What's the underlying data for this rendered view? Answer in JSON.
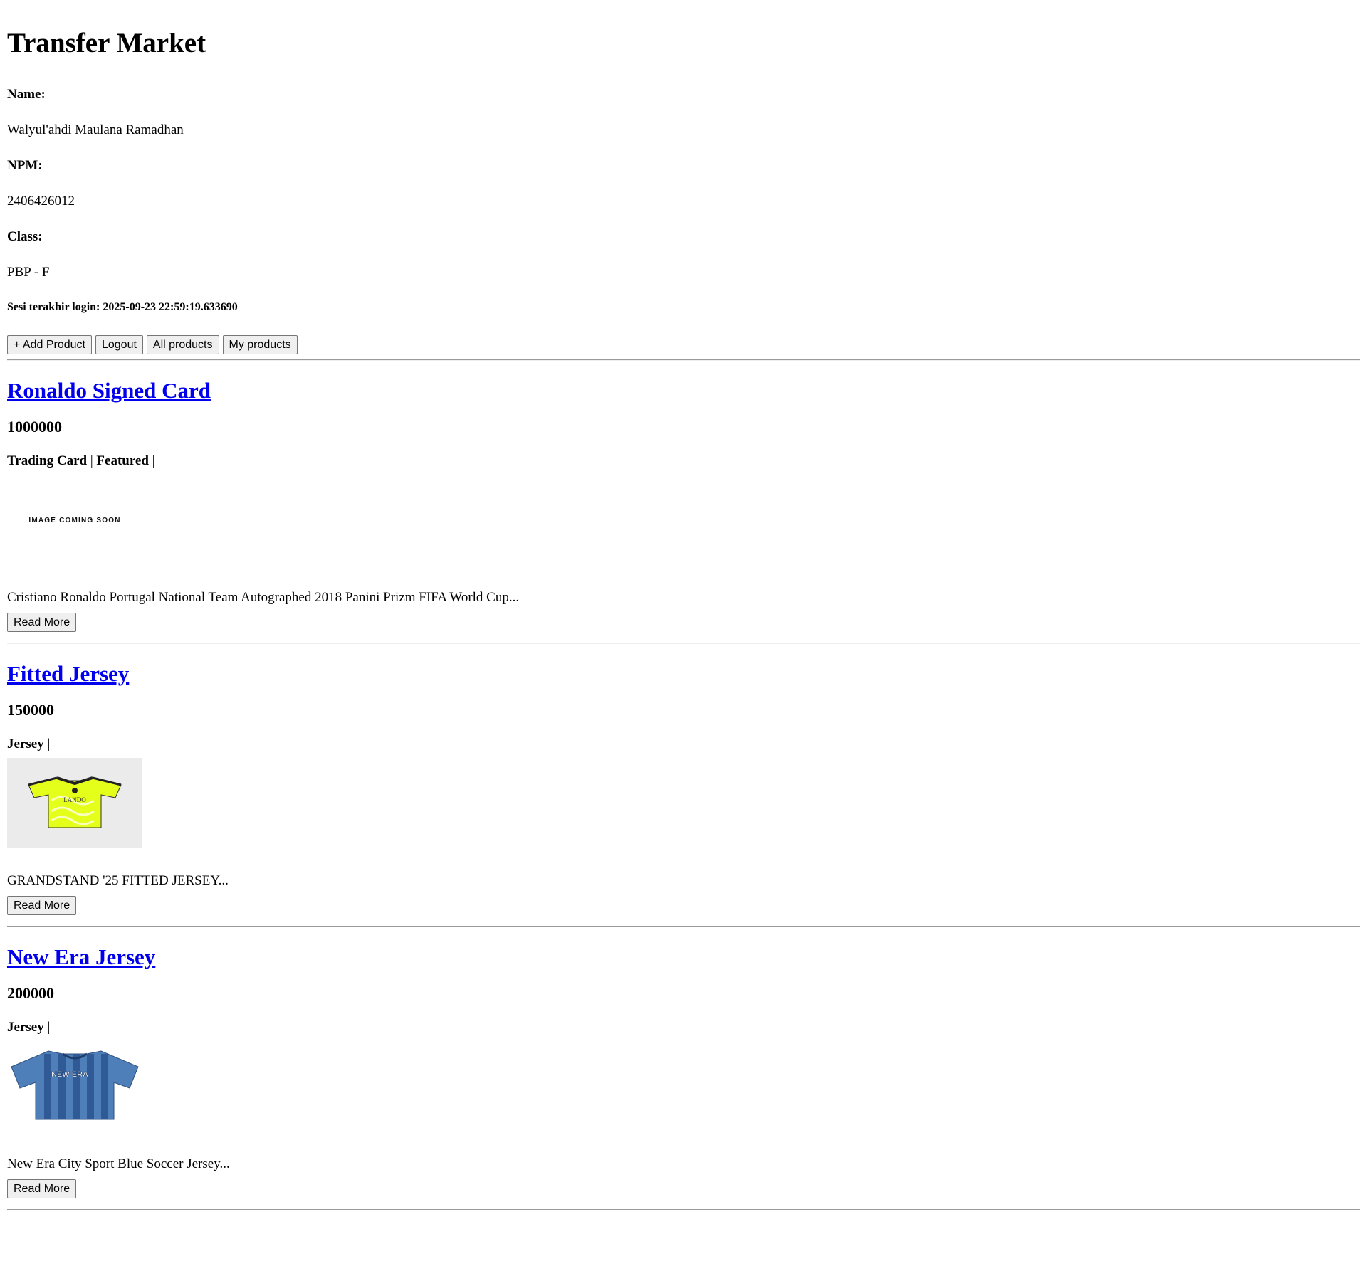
{
  "header": {
    "title": "Transfer Market",
    "name_label": "Name:",
    "name_value": "Walyul'ahdi Maulana Ramadhan",
    "npm_label": "NPM:",
    "npm_value": "2406426012",
    "class_label": "Class:",
    "class_value": "PBP - F",
    "last_login": "Sesi terakhir login: 2025-09-23 22:59:19.633690"
  },
  "actions": {
    "add_product": "+ Add Product",
    "logout": "Logout",
    "all_products": "All products",
    "my_products": "My products"
  },
  "products": [
    {
      "title": "Ronaldo Signed Card",
      "price": "1000000",
      "tags": [
        "Trading Card",
        "Featured"
      ],
      "image_text": "IMAGE COMING SOON",
      "description": "Cristiano Ronaldo Portugal National Team Autographed 2018 Panini Prizm FIFA World Cup...",
      "read_more": "Read More"
    },
    {
      "title": "Fitted Jersey",
      "price": "150000",
      "tags": [
        "Jersey"
      ],
      "image_text": "LANDO",
      "description": "GRANDSTAND '25 FITTED JERSEY...",
      "read_more": "Read More"
    },
    {
      "title": "New Era Jersey",
      "price": "200000",
      "tags": [
        "Jersey"
      ],
      "image_text": "NEW ERA",
      "description": "New Era City Sport Blue Soccer Jersey...",
      "read_more": "Read More"
    }
  ],
  "colors": {
    "link": "#0000ee",
    "jersey_neon": "#e4ff1a",
    "jersey_blue": "#4f7fb8"
  }
}
